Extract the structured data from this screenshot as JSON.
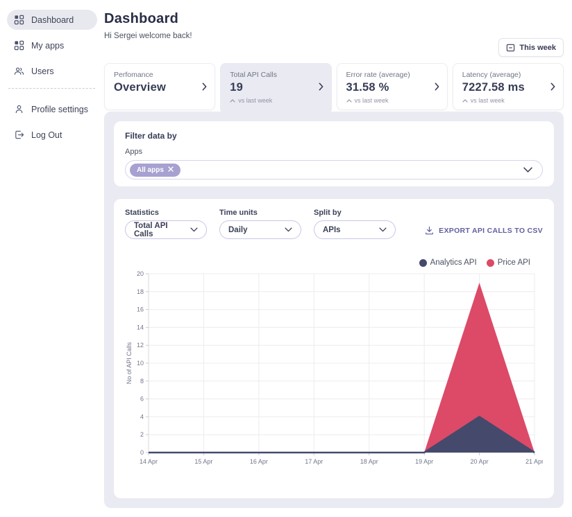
{
  "sidebar": {
    "items": [
      {
        "label": "Dashboard",
        "icon": "dashboard-grid-icon",
        "active": true
      },
      {
        "label": "My apps",
        "icon": "apps-grid-icon",
        "active": false
      },
      {
        "label": "Users",
        "icon": "users-icon",
        "active": false
      },
      {
        "label": "Profile settings",
        "icon": "profile-icon",
        "active": false
      },
      {
        "label": "Log Out",
        "icon": "logout-icon",
        "active": false
      }
    ]
  },
  "header": {
    "title": "Dashboard",
    "greeting": "Hi Sergei welcome back!",
    "period_button": "This week"
  },
  "tabs": [
    {
      "label": "Perfomance",
      "value": "Overview",
      "compare": "",
      "active": false
    },
    {
      "label": "Total API Calls",
      "value": "19",
      "compare": "vs last week",
      "active": true
    },
    {
      "label": "Error rate (average)",
      "value": "31.58 %",
      "compare": "vs last week",
      "active": false
    },
    {
      "label": "Latency (average)",
      "value": "7227.58 ms",
      "compare": "vs last week",
      "active": false
    }
  ],
  "filter": {
    "heading": "Filter data by",
    "apps_label": "Apps",
    "chip": "All apps"
  },
  "controls": {
    "statistics_label": "Statistics",
    "statistics_value": "Total API Calls",
    "time_units_label": "Time units",
    "time_units_value": "Daily",
    "split_by_label": "Split by",
    "split_by_value": "APIs",
    "export_label": "EXPORT API CALLS TO CSV"
  },
  "chart_data": {
    "type": "area",
    "stacked": true,
    "x": [
      "14 Apr",
      "15 Apr",
      "16 Apr",
      "17 Apr",
      "18 Apr",
      "19 Apr",
      "20 Apr",
      "21 Apr"
    ],
    "series": [
      {
        "name": "Analytics API",
        "color": "#454a6c",
        "values": [
          0,
          0,
          0,
          0,
          0,
          0,
          4,
          0
        ]
      },
      {
        "name": "Price API",
        "color": "#dc4a68",
        "values": [
          0,
          0,
          0,
          0,
          0,
          0,
          15,
          0
        ]
      }
    ],
    "title": "",
    "xlabel": "",
    "ylabel": "No of API Calls",
    "ylim": [
      0,
      20
    ],
    "ytick_step": 2,
    "grid": true,
    "legend_position": "top-right"
  },
  "colors": {
    "accent_navy": "#454a6c",
    "series_pink": "#dc4a68",
    "chip_purple": "#a7a1d1",
    "panel_bg": "#e9eaf2",
    "export_link": "#615f9e"
  }
}
